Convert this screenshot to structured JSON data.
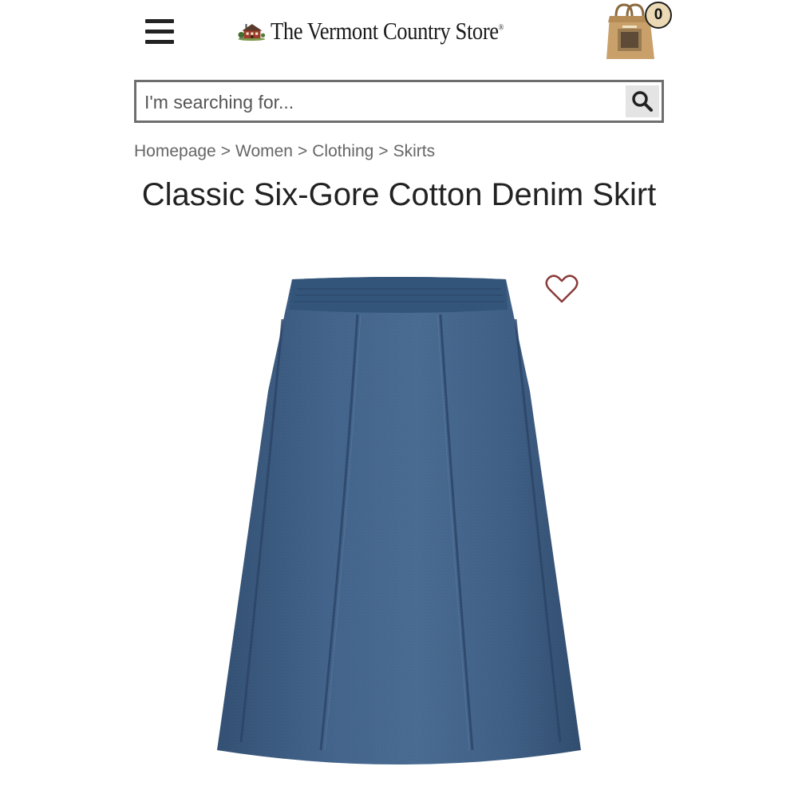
{
  "header": {
    "logo_text": "The Vermont Country Store",
    "logo_mark": "®",
    "cart_count": "0"
  },
  "search": {
    "placeholder": "I'm searching for..."
  },
  "breadcrumb": {
    "items": [
      "Homepage",
      "Women",
      "Clothing",
      "Skirts"
    ],
    "separator": ">"
  },
  "product": {
    "title": "Classic Six-Gore Cotton Denim Skirt"
  },
  "colors": {
    "heart": "#8a3b3b",
    "denim": "#3d5c80",
    "search_border": "#6e6e6e"
  },
  "icons": [
    "hamburger-menu-icon",
    "house-logo-icon",
    "shopping-bag-icon",
    "search-icon",
    "heart-icon"
  ]
}
